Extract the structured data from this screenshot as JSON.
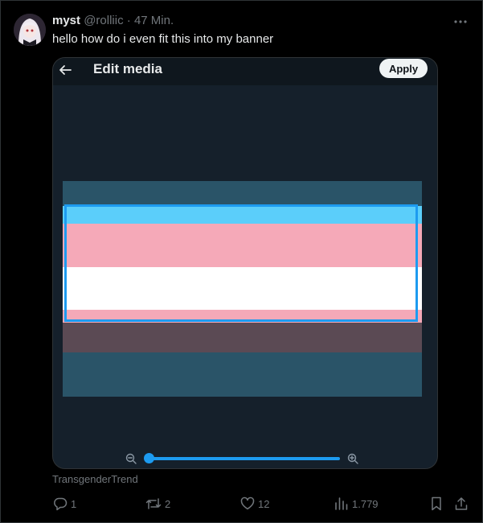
{
  "tweet": {
    "author_name": "myst",
    "handle": "@rolliic",
    "separator": "·",
    "time": "47 Min.",
    "text": "hello how do i even fit this into my banner"
  },
  "editor": {
    "title": "Edit media",
    "apply_label": "Apply",
    "zoom_level": 0
  },
  "colors": {
    "accent": "#1d9bf0",
    "flag_blue": "#5bcefa",
    "flag_pink": "#f5a9b8",
    "flag_white": "#ffffff",
    "background": "#000000"
  },
  "source_label": "TransgenderTrend",
  "actions": {
    "reply_count": "1",
    "retweet_count": "2",
    "like_count": "12",
    "view_count": "1.779"
  },
  "icons": [
    "back-arrow-icon",
    "more-icon",
    "zoom-out-icon",
    "zoom-in-icon",
    "reply-icon",
    "retweet-icon",
    "like-icon",
    "views-icon",
    "bookmark-icon",
    "share-icon"
  ]
}
